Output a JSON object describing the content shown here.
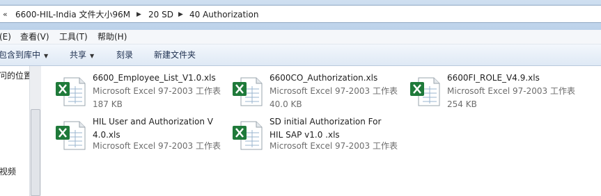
{
  "address": {
    "overflow_icon": "«",
    "crumbs": [
      "6600-HIL-India 文件大小96M",
      "20 SD",
      "40 Authorization"
    ]
  },
  "menu": [
    "(E)",
    "查看(V)",
    "工具(T)",
    "帮助(H)"
  ],
  "commands": {
    "include": "包含到库中",
    "share": "共享",
    "burn": "刻录",
    "new_folder": "新建文件夹"
  },
  "nav": {
    "items": [
      "问的位置",
      "视频"
    ]
  },
  "files": [
    {
      "name": "6600_Employee_List_V1.0.xls",
      "type": "Microsoft Excel 97-2003 工作表",
      "size": "187 KB",
      "icon": "excel-file-icon"
    },
    {
      "name": "6600CO_Authorization.xls",
      "type": "Microsoft Excel 97-2003 工作表",
      "size": "40.0 KB",
      "icon": "excel-file-icon"
    },
    {
      "name": "6600FI_ROLE_V4.9.xls",
      "type": "Microsoft Excel 97-2003 工作表",
      "size": "254 KB",
      "icon": "excel-file-icon"
    },
    {
      "name": "HIL User and Authorization V 4.0.xls",
      "type": "Microsoft Excel 97-2003 工作表",
      "size": "",
      "icon": "excel-file-icon"
    },
    {
      "name": "SD initial Authorization For HIL SAP v1.0 .xls",
      "type": "Microsoft Excel 97-2003 工作表",
      "size": "",
      "icon": "excel-file-icon"
    }
  ],
  "colors": {
    "excel_green": "#1f7a3a",
    "address_bg": "#bcd2ea",
    "command_bar": "#dfe9f5"
  }
}
